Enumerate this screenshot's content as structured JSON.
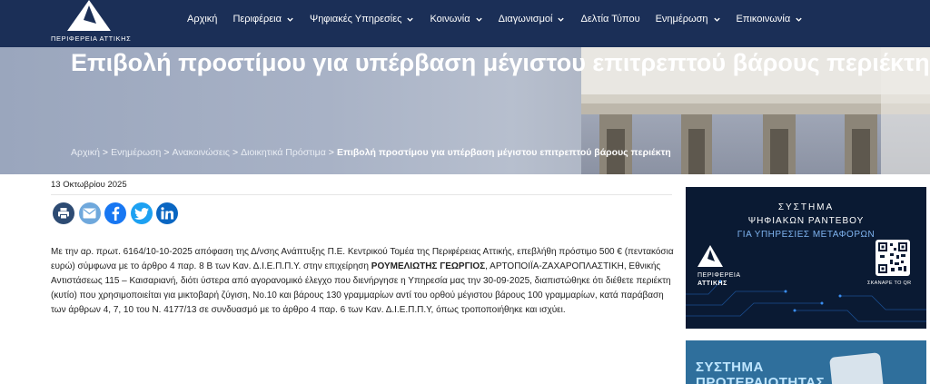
{
  "header": {
    "logo_text": "ΠΕΡΙΦΕΡΕΙΑ ΑΤΤΙΚΗΣ",
    "nav": [
      {
        "label": "Αρχική",
        "dropdown": false
      },
      {
        "label": "Περιφέρεια",
        "dropdown": true
      },
      {
        "label": "Ψηφιακές Υπηρεσίες",
        "dropdown": true
      },
      {
        "label": "Κοινωνία",
        "dropdown": true
      },
      {
        "label": "Διαγωνισμοί",
        "dropdown": true
      },
      {
        "label": "Δελτία Τύπου",
        "dropdown": false
      },
      {
        "label": "Ενημέρωση",
        "dropdown": true
      },
      {
        "label": "Επικοινωνία",
        "dropdown": true
      }
    ]
  },
  "hero": {
    "title": "Επιβολή προστίμου για υπέρβαση μέγιστου επιτρεπτού βάρους περιέκτη",
    "breadcrumbs": [
      "Αρχική",
      "Ενημέρωση",
      "Ανακοινώσεις",
      "Διοικητικά Πρόστιμα"
    ],
    "breadcrumb_current": "Επιβολή προστίμου για υπέρβαση μέγιστου επιτρεπτού βάρους περιέκτη",
    "separator": ">"
  },
  "article": {
    "date": "13 Οκτωβρίου 2025",
    "share": [
      {
        "icon": "print-icon",
        "color": "#2d4b73"
      },
      {
        "icon": "email-icon",
        "color": "#6fa8dc"
      },
      {
        "icon": "facebook-icon",
        "color": "#1877f2"
      },
      {
        "icon": "twitter-icon",
        "color": "#1da1f2"
      },
      {
        "icon": "linkedin-icon",
        "color": "#0a66c2"
      }
    ],
    "body_part1": "Με την αρ. πρωτ. 6164/10-10-2025 απόφαση της Δ/νσης Ανάπτυξης Π.Ε. Κεντρικού Τομέα της Περιφέρειας Αττικής, επεβλήθη πρόστιμο 500 € (πεντακόσια ευρώ) σύμφωνα με το άρθρο 4 παρ. 8 Β των Καν. Δ.Ι.Ε.Π.Π.Υ. στην επιχείρηση ",
    "body_bold": "ΡΟΥΜΕΛΙΩΤΗΣ ΓΕΩΡΓΙΟΣ",
    "body_part2": ", ΑΡΤΟΠΟΙΪΑ-ΖΑΧΑΡΟΠΛΑΣΤΙΚΗ, Εθνικής Αντιστάσεως 115 – Καισαριανή, διότι ύστερα από αγορανομικό έλεγχο που διενήργησε η Υπηρεσία μας την 30-09-2025, διαπιστώθηκε ότι διέθετε περιέκτη (κυτίο) που χρησιμοποιείται για μικτοβαρή ζύγιση, Νο.10 και βάρους 130 γραμμαρίων αντί του ορθού μέγιστου βάρους 100 γραμμαρίων, κατά παράβαση των άρθρων 4, 7, 10 του Ν. 4177/13 σε συνδυασμό με το άρθρο 4 παρ. 6 των Καν. Δ.Ι.Ε.Π.Π.Υ, όπως τροποποιήθηκε και ισχύει."
  },
  "sidebar": {
    "banner1": {
      "line1": "ΣΥΣΤΗΜΑ",
      "line2": "ΨΗΦΙΑΚΩΝ ΡΑΝΤΕΒΟΥ",
      "line3": "ΓΙΑ ΥΠΗΡΕΣΙΕΣ ΜΕΤΑΦΟΡΩΝ",
      "org1": "ΠΕΡΙΦΕΡΕΙΑ",
      "org2": "ΑΤΤΙΚΗΣ",
      "qr_label": "ΣΚΑΝΑΡΕ ΤΟ QR"
    },
    "banner2": {
      "line1": "ΣΥΣΤΗΜΑ",
      "line2": "ΠΡΟΤΕΡΑΙΟΤΗΤΑΣ"
    }
  }
}
